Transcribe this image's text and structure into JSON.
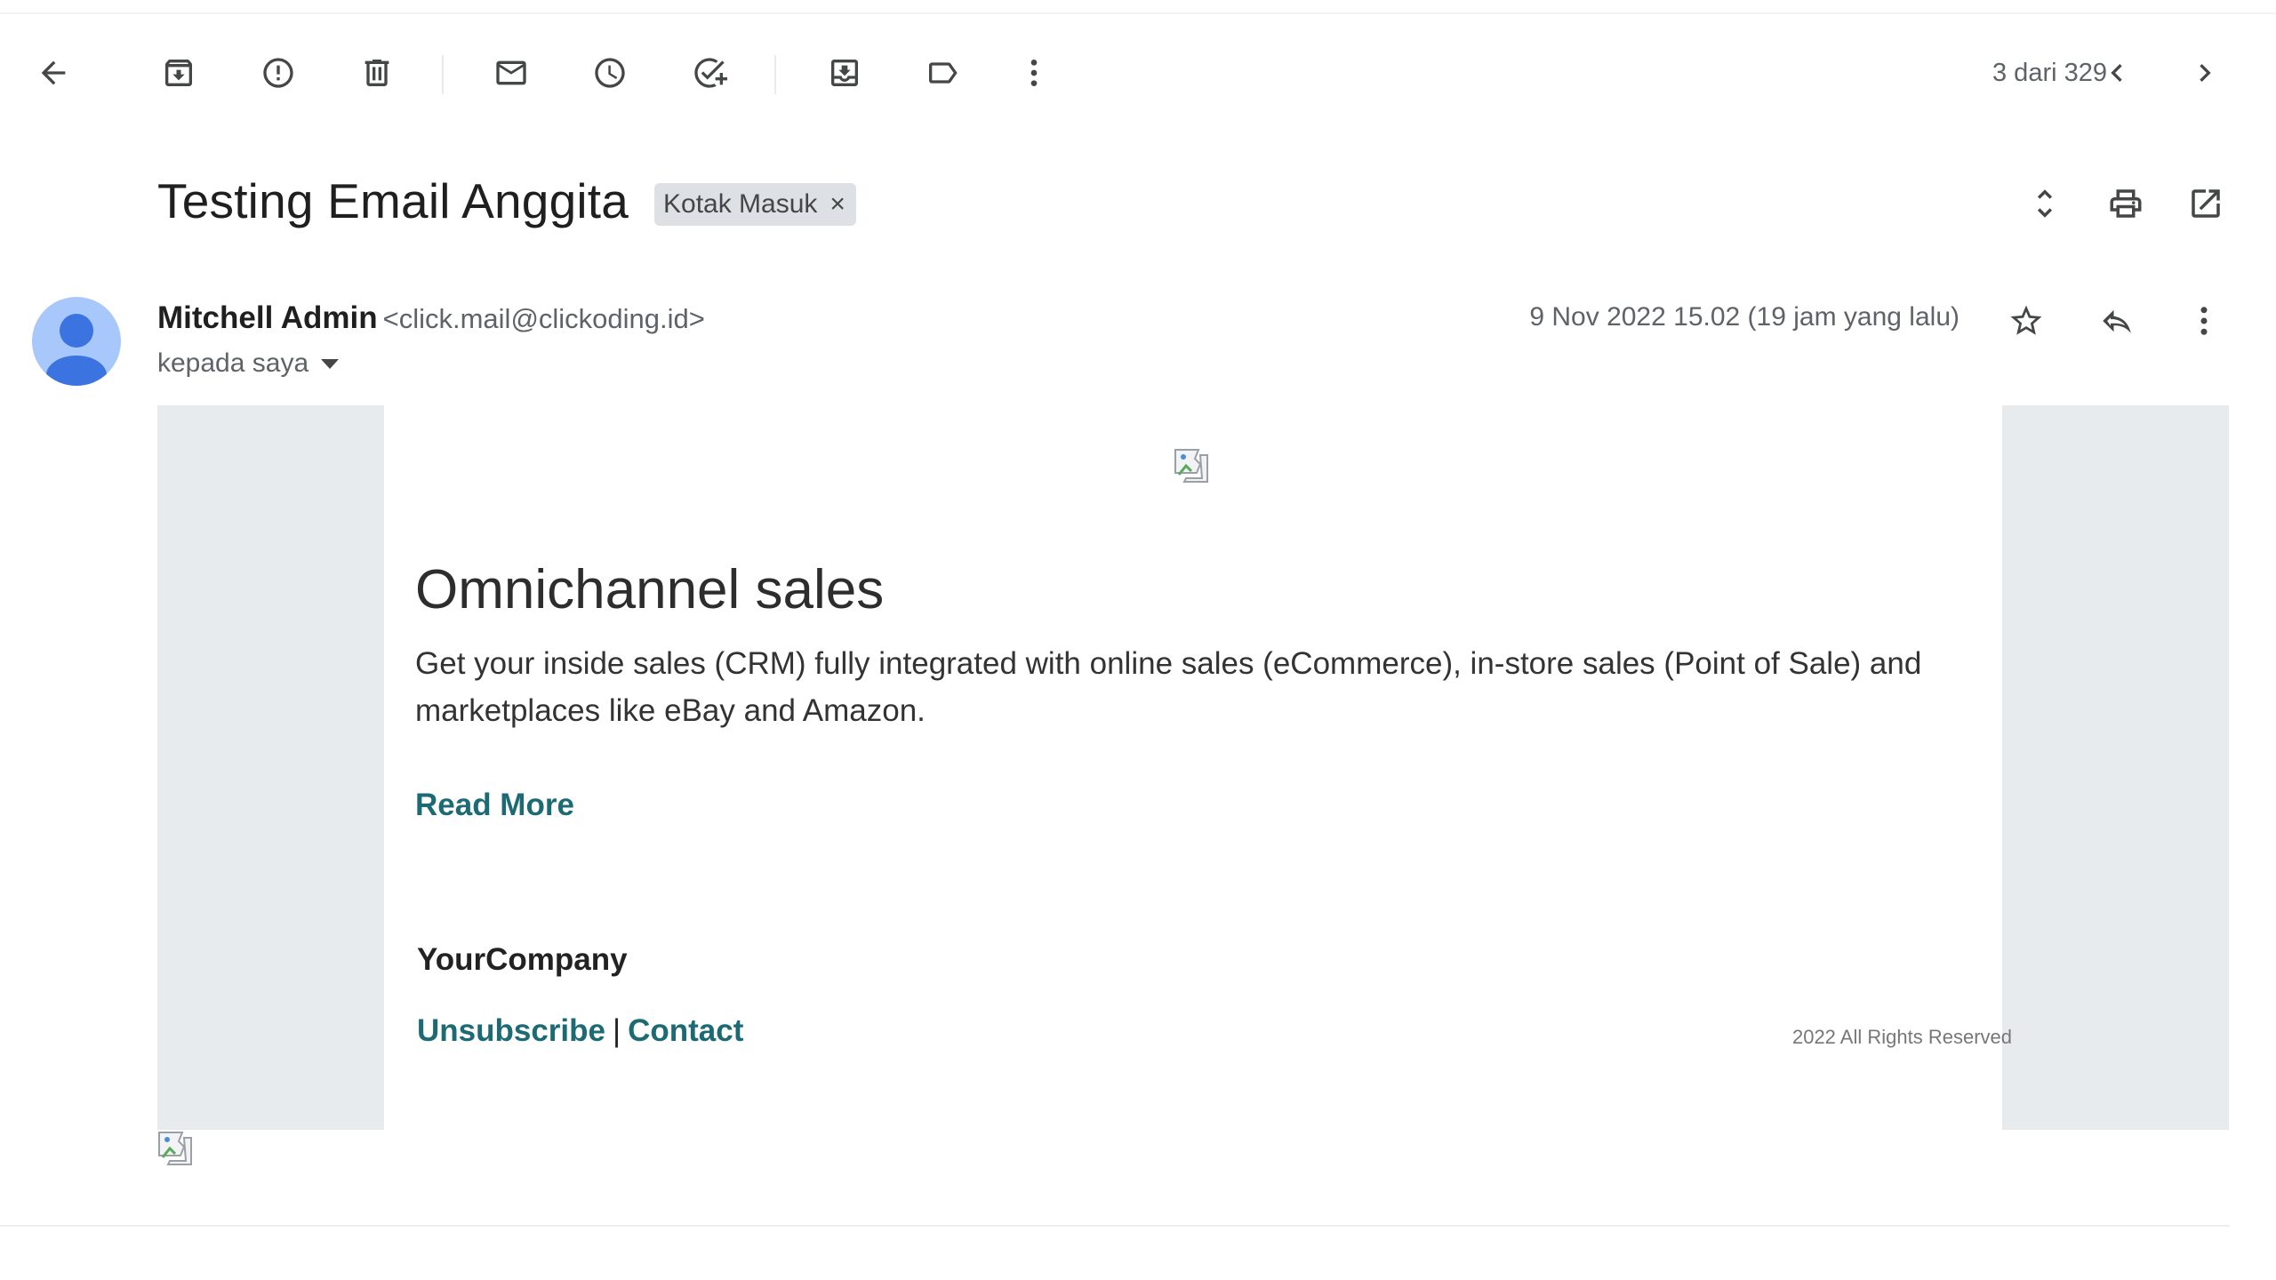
{
  "toolbar": {
    "back_icon": "arrow-left-icon",
    "archive_icon": "archive-icon",
    "spam_icon": "report-spam-icon",
    "delete_icon": "trash-icon",
    "mark_unread_icon": "envelope-icon",
    "snooze_icon": "clock-icon",
    "add_task_icon": "add-task-icon",
    "move_icon": "move-to-icon",
    "label_icon": "label-icon",
    "more_icon": "more-vert-icon",
    "counter": "3 dari 329",
    "prev_icon": "chevron-left-icon",
    "next_icon": "chevron-right-icon"
  },
  "subject": {
    "title": "Testing Email Anggita",
    "label": "Kotak Masuk",
    "label_remove": "×",
    "expand_icon": "unfold-icon",
    "print_icon": "printer-icon",
    "popout_icon": "open-in-new-icon"
  },
  "message": {
    "sender_name": "Mitchell Admin",
    "sender_email": "<click.mail@clickoding.id>",
    "to": "kepada saya",
    "date": "9 Nov 2022 15.02 (19 jam yang lalu)",
    "star_icon": "star-icon",
    "reply_icon": "reply-icon",
    "more_icon": "more-vert-icon"
  },
  "body": {
    "headline": "Omnichannel sales",
    "paragraph": "Get your inside sales (CRM) fully integrated with online sales (eCommerce), in-store sales (Point of Sale) and marketplaces like eBay and Amazon.",
    "read_more": "Read More",
    "company": "YourCompany",
    "unsubscribe": "Unsubscribe",
    "separator": "|",
    "contact": "Contact",
    "rights": "2022 All Rights Reserved"
  },
  "colors": {
    "link": "#1c6b74",
    "side_panel": "#e8ebee",
    "chip": "#dde1e5",
    "avatar": "#a8c7fa"
  }
}
